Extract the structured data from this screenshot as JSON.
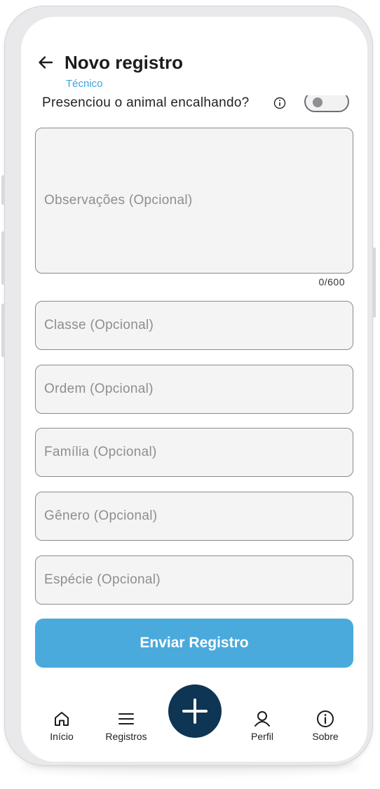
{
  "header": {
    "title": "Novo registro",
    "subtitle": "Técnico",
    "back_icon": "arrow-left-icon"
  },
  "toggle": {
    "label": "Presenciou o animal encalhando?",
    "info_icon": "info-icon",
    "enabled": false
  },
  "fields": {
    "observacoes": "Observações (Opcional)",
    "counter": "0/600",
    "classe": "Classe (Opcional)",
    "ordem": "Ordem (Opcional)",
    "familia": "Família (Opcional)",
    "genero": "Gênero (Opcional)",
    "especie": "Espécie (Opcional)"
  },
  "submit_label": "Enviar Registro",
  "nav": {
    "inicio": "Início",
    "registros": "Registros",
    "add_icon": "plus-icon",
    "perfil": "Perfil",
    "sobre": "Sobre"
  },
  "colors": {
    "accent": "#4aaadc",
    "fab": "#0e3553",
    "subtitle": "#3ba4dc"
  }
}
